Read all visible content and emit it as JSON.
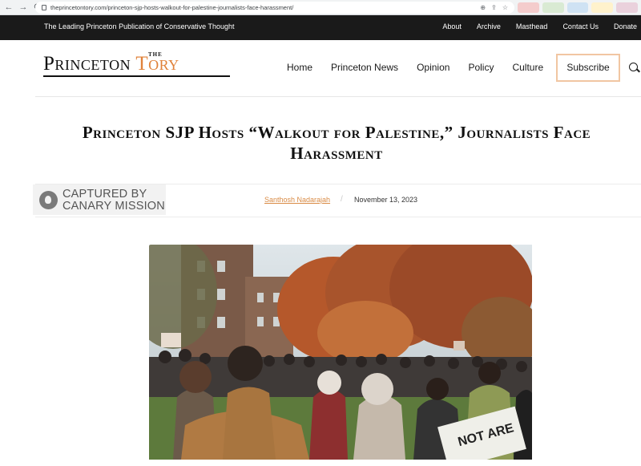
{
  "browser": {
    "url": "theprincetontory.com/princeton-sjp-hosts-walkout-for-palestine-journalists-face-harassment/",
    "ext_colors": [
      "#f4cccc",
      "#d9ead3",
      "#cfe2f3",
      "#fff2cc",
      "#ead1dc"
    ]
  },
  "topbar": {
    "tagline": "The Leading Princeton Publication of Conservative Thought",
    "links": [
      "About",
      "Archive",
      "Masthead",
      "Contact Us",
      "Donate"
    ]
  },
  "logo": {
    "the": "THE",
    "princeton": "Princeton",
    "tory": "Tory"
  },
  "nav": {
    "items": [
      "Home",
      "Princeton News",
      "Opinion",
      "Policy",
      "Culture"
    ],
    "subscribe": "Subscribe"
  },
  "article": {
    "title": "Princeton SJP Hosts “Walkout for Palestine,” Journalists Face Harassment",
    "author": "Santhosh Nadarajah",
    "separator": "/",
    "date": "November 13, 2023"
  },
  "watermark": {
    "line1": "CAPTURED BY",
    "line2": "CANARY MISSION"
  },
  "photo": {
    "sign_text": "NOT ARE"
  },
  "colors": {
    "accent": "#e0823a",
    "topbar": "#1a1a1a"
  }
}
